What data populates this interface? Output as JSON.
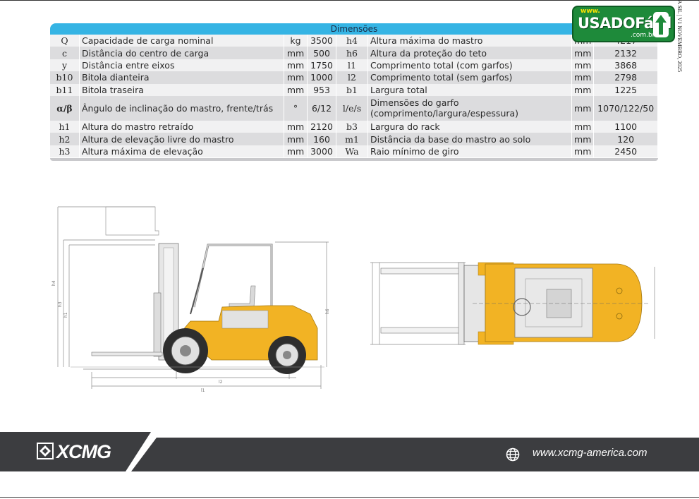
{
  "sidebar_text": "A SIL | V1 NOVEMBRO, 2025",
  "table": {
    "title": "Dimensões",
    "rows": [
      {
        "s1": "Q",
        "d1": "Capacidade de carga nominal",
        "u1": "kg",
        "v1": "3500",
        "s2": "h4",
        "d2": "Altura máxima do mastro",
        "u2": "mm",
        "v2": "4217"
      },
      {
        "s1": "c",
        "d1": "Distância do centro de carga",
        "u1": "mm",
        "v1": "500",
        "s2": "h6",
        "d2": "Altura da proteção do teto",
        "u2": "mm",
        "v2": "2132"
      },
      {
        "s1": "y",
        "d1": "Distância entre eixos",
        "u1": "mm",
        "v1": "1750",
        "s2": "l1",
        "d2": "Comprimento total (com garfos)",
        "u2": "mm",
        "v2": "3868"
      },
      {
        "s1": "b10",
        "d1": "Bitola dianteira",
        "u1": "mm",
        "v1": "1000",
        "s2": "l2",
        "d2": "Comprimento total (sem garfos)",
        "u2": "mm",
        "v2": "2798"
      },
      {
        "s1": "b11",
        "d1": "Bitola traseira",
        "u1": "mm",
        "v1": "953",
        "s2": "b1",
        "d2": "Largura total",
        "u2": "mm",
        "v2": "1225"
      },
      {
        "s1": "α/β",
        "d1": "Ângulo de inclinação do mastro, frente/trás",
        "u1": "°",
        "v1": "6/12",
        "s2": "l/e/s",
        "d2": "Dimensões do garfo (comprimento/largura/espessura)",
        "u2": "mm",
        "v2": "1070/122/50"
      },
      {
        "s1": "h1",
        "d1": "Altura do mastro retraído",
        "u1": "mm",
        "v1": "2120",
        "s2": "b3",
        "d2": "Largura do rack",
        "u2": "mm",
        "v2": "1100"
      },
      {
        "s1": "h2",
        "d1": "Altura de elevação livre do mastro",
        "u1": "mm",
        "v1": "160",
        "s2": "m1",
        "d2": "Distância da base do mastro ao solo",
        "u2": "mm",
        "v2": "120"
      },
      {
        "s1": "h3",
        "d1": "Altura máxima de elevação",
        "u1": "mm",
        "v1": "3000",
        "s2": "Wa",
        "d2": "Raio mínimo de giro",
        "u2": "mm",
        "v2": "2450"
      }
    ]
  },
  "watermark": {
    "www": "www.",
    "brand": "USADOFácil",
    "domain": ".com.br"
  },
  "footer": {
    "brand": "XCMG",
    "url": "www.xcmg-america.com"
  },
  "colors": {
    "header_blue": "#35b4e4",
    "forklift_yellow": "#f2b324",
    "footer_dark": "#3c3d40",
    "usado_green": "#1e8a3a"
  }
}
